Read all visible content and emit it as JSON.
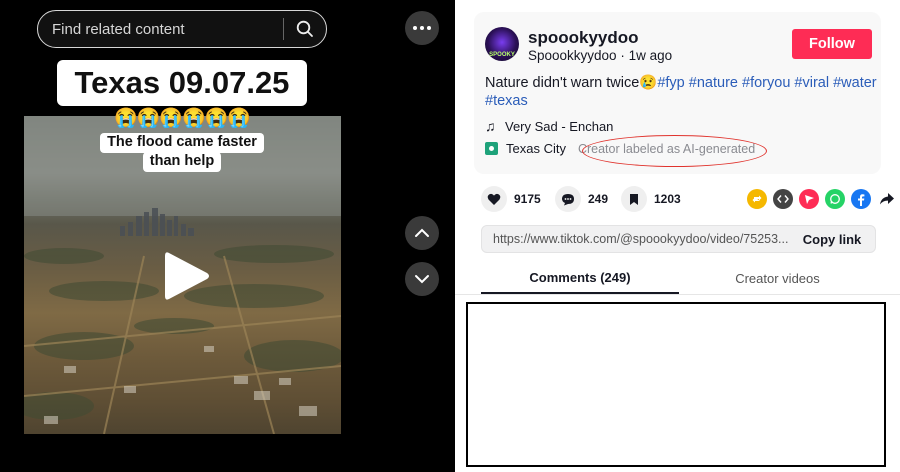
{
  "search": {
    "placeholder": "Find related content",
    "icon": "search-icon"
  },
  "more_icon": "ellipsis-icon",
  "video": {
    "title": "Texas 09.07.25",
    "emojis": "😭😭😭😭😭😭",
    "caption_line1": "The flood came faster",
    "caption_line2": "than help",
    "play_icon": "play-icon"
  },
  "nav": {
    "up_icon": "chevron-up-icon",
    "down_icon": "chevron-down-icon"
  },
  "author": {
    "username": "spoookyydoo",
    "handle": "Spoookkyydoo",
    "separator": " · ",
    "posted": "1w ago",
    "avatar_badge": "SPOOKY",
    "follow_label": "Follow"
  },
  "post": {
    "text": "Nature didn't warn twice😢",
    "hashtags": [
      "#fyp",
      "#nature",
      "#foryou",
      "#viral",
      "#water",
      "#texas"
    ],
    "music": "Very Sad - Enchan",
    "location": "Texas City",
    "ai_label": "Creator labeled as AI-generated"
  },
  "stats": {
    "likes": "9175",
    "comments": "249",
    "saves": "1203"
  },
  "share_icons": [
    "repost-icon",
    "embed-icon",
    "send-icon",
    "whatsapp-icon",
    "facebook-icon",
    "share-arrow-icon"
  ],
  "link": {
    "url": "https://www.tiktok.com/@spoookyydoo/video/75253...",
    "copy_label": "Copy link"
  },
  "tabs": {
    "comments": "Comments (249)",
    "creator": "Creator videos"
  },
  "colors": {
    "follow": "#fe2c55",
    "hashtag": "#2b5db9",
    "annotation": "#e0332d"
  }
}
